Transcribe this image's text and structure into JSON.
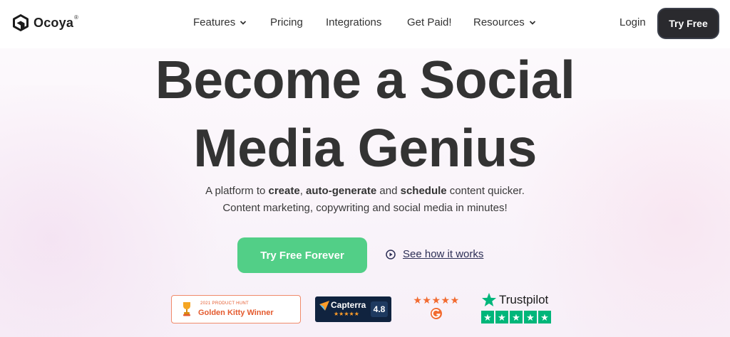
{
  "brand": {
    "name": "Ocoya",
    "reg_mark": "®"
  },
  "nav": [
    {
      "label": "Features",
      "has_dropdown": true
    },
    {
      "label": "Pricing",
      "has_dropdown": false
    },
    {
      "label": "Integrations",
      "has_dropdown": false
    },
    {
      "label": "Get Paid!",
      "has_dropdown": false
    },
    {
      "label": "Resources",
      "has_dropdown": true
    }
  ],
  "header_actions": {
    "login_label": "Login",
    "try_free_label": "Try Free"
  },
  "hero": {
    "title_line1": "Become a Social",
    "title_line2": "Media Genius",
    "subtitle_line1_prefix": "A platform to ",
    "subtitle_create": "create",
    "subtitle_sep": ", ",
    "subtitle_autogen": "auto-generate",
    "subtitle_and": " and ",
    "subtitle_schedule": "schedule",
    "subtitle_line1_suffix": " content quicker.",
    "subtitle_line2": "Content marketing, copywriting and social media in minutes!"
  },
  "cta": {
    "primary_label": "Try Free Forever",
    "secondary_label": "See how it works"
  },
  "badges": {
    "producthunt": {
      "small": "2021 PRODUCT HUNT",
      "big": "Golden Kitty Winner"
    },
    "capterra": {
      "name": "Capterra",
      "stars": "★★★★★",
      "score": "4.8"
    },
    "g2": {
      "stars": "★★★★★"
    },
    "trustpilot": {
      "name": "Trustpilot",
      "stars": "★",
      "rating_stars": 5
    }
  },
  "colors": {
    "accent_green": "#52cf87",
    "dark_button": "#2a2a2e",
    "trustpilot_green": "#00b67a",
    "producthunt_orange": "#e45a2e",
    "capterra_navy": "#10233f",
    "g2_orange": "#f26b30"
  },
  "icons": {
    "brand_logo": "hexagon-logo-icon",
    "dropdown": "chevron-down-icon",
    "play": "play-circle-icon",
    "trophy": "trophy-icon",
    "capterra": "capterra-arrow-icon",
    "g2": "g2-logo-icon",
    "trustpilot": "trustpilot-star-icon"
  }
}
